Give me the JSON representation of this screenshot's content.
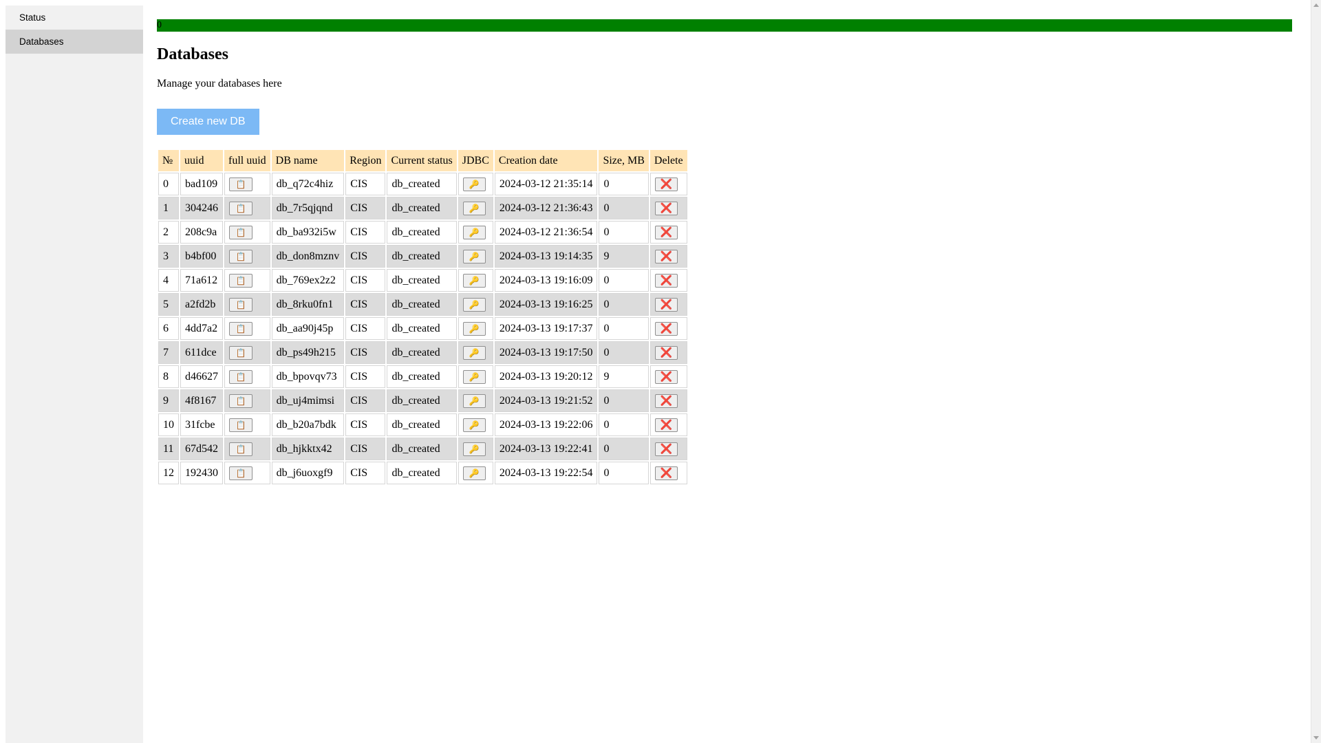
{
  "sidebar": {
    "items": [
      {
        "label": "Status",
        "active": false
      },
      {
        "label": "Databases",
        "active": true
      }
    ]
  },
  "progress": {
    "text": "0",
    "value_percent": 100,
    "color": "#008000"
  },
  "header": {
    "title": "Databases",
    "subtitle": "Manage your databases here"
  },
  "create_button": {
    "label": "Create new DB",
    "color": "#7cb9f5"
  },
  "table": {
    "columns": [
      "№",
      "uuid",
      "full uuid",
      "DB name",
      "Region",
      "Current status",
      "JDBC",
      "Creation date",
      "Size, MB",
      "Delete"
    ],
    "icons": {
      "copy": "clipboard-icon",
      "jdbc": "key-icon",
      "delete": "cross-icon"
    },
    "rows": [
      {
        "n": "0",
        "uuid": "bad109",
        "db_name": "db_q72c4hiz",
        "region": "CIS",
        "status": "db_created",
        "created": "2024-03-12 21:35:14",
        "size": "0"
      },
      {
        "n": "1",
        "uuid": "304246",
        "db_name": "db_7r5qjqnd",
        "region": "CIS",
        "status": "db_created",
        "created": "2024-03-12 21:36:43",
        "size": "0"
      },
      {
        "n": "2",
        "uuid": "208c9a",
        "db_name": "db_ba932i5w",
        "region": "CIS",
        "status": "db_created",
        "created": "2024-03-12 21:36:54",
        "size": "0"
      },
      {
        "n": "3",
        "uuid": "b4bf00",
        "db_name": "db_don8mznv",
        "region": "CIS",
        "status": "db_created",
        "created": "2024-03-13 19:14:35",
        "size": "9"
      },
      {
        "n": "4",
        "uuid": "71a612",
        "db_name": "db_769ex2z2",
        "region": "CIS",
        "status": "db_created",
        "created": "2024-03-13 19:16:09",
        "size": "0"
      },
      {
        "n": "5",
        "uuid": "a2fd2b",
        "db_name": "db_8rku0fn1",
        "region": "CIS",
        "status": "db_created",
        "created": "2024-03-13 19:16:25",
        "size": "0"
      },
      {
        "n": "6",
        "uuid": "4dd7a2",
        "db_name": "db_aa90j45p",
        "region": "CIS",
        "status": "db_created",
        "created": "2024-03-13 19:17:37",
        "size": "0"
      },
      {
        "n": "7",
        "uuid": "611dce",
        "db_name": "db_ps49h215",
        "region": "CIS",
        "status": "db_created",
        "created": "2024-03-13 19:17:50",
        "size": "0"
      },
      {
        "n": "8",
        "uuid": "d46627",
        "db_name": "db_bpovqv73",
        "region": "CIS",
        "status": "db_created",
        "created": "2024-03-13 19:20:12",
        "size": "9"
      },
      {
        "n": "9",
        "uuid": "4f8167",
        "db_name": "db_uj4mimsi",
        "region": "CIS",
        "status": "db_created",
        "created": "2024-03-13 19:21:52",
        "size": "0"
      },
      {
        "n": "10",
        "uuid": "31fcbe",
        "db_name": "db_b20a7bdk",
        "region": "CIS",
        "status": "db_created",
        "created": "2024-03-13 19:22:06",
        "size": "0"
      },
      {
        "n": "11",
        "uuid": "67d542",
        "db_name": "db_hjkktx42",
        "region": "CIS",
        "status": "db_created",
        "created": "2024-03-13 19:22:41",
        "size": "0"
      },
      {
        "n": "12",
        "uuid": "192430",
        "db_name": "db_j6uoxgf9",
        "region": "CIS",
        "status": "db_created",
        "created": "2024-03-13 19:22:54",
        "size": "0"
      }
    ]
  }
}
